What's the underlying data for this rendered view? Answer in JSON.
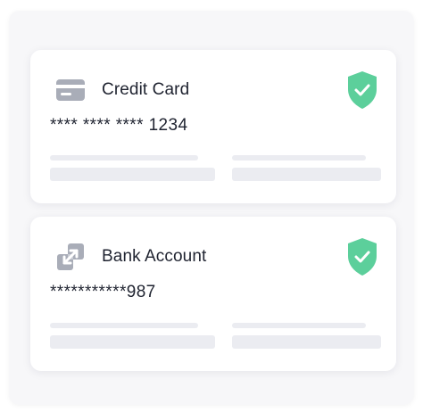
{
  "payment_methods": [
    {
      "label": "Credit Card",
      "masked_number": "**** **** **** 1234",
      "icon": "credit-card-icon",
      "verified_icon": "shield-check-icon"
    },
    {
      "label": "Bank Account",
      "masked_number": "***********987",
      "icon": "bank-transfer-icon",
      "verified_icon": "shield-check-icon"
    }
  ],
  "colors": {
    "shield": "#5ccf9b",
    "icon_gray": "#a9adb8",
    "placeholder_bar": "#ebecf1",
    "text": "#1f2330"
  }
}
